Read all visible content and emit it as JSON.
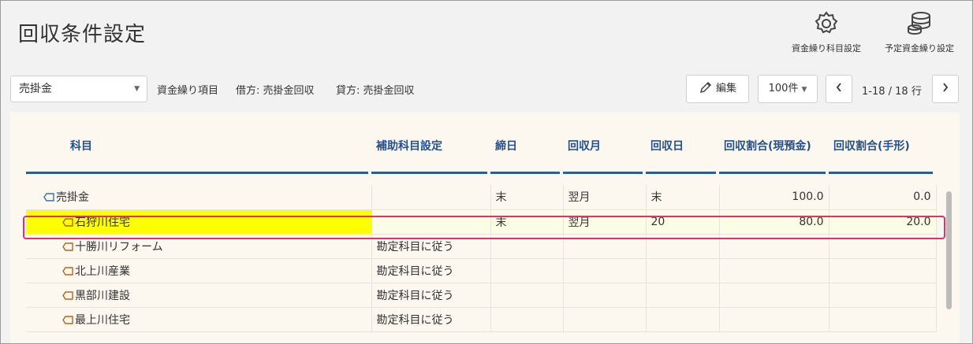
{
  "page": {
    "title": "回収条件設定"
  },
  "header_actions": [
    {
      "label": "資金繰り科目設定",
      "icon": "gear-icon"
    },
    {
      "label": "予定資金繰り設定",
      "icon": "database-icon"
    }
  ],
  "toolbar": {
    "account_select": {
      "value": "売掛金"
    },
    "cashflow_item_label": "資金繰り項目",
    "debit_text": "借方: 売掛金回収",
    "credit_text": "貸方: 売掛金回収",
    "edit_label": "編集",
    "page_size": "100件",
    "paging_text": "1-18 / 18 行"
  },
  "table": {
    "headers": {
      "subject": "科目",
      "sub_setting": "補助科目設定",
      "closing_day": "締日",
      "collection_month": "回収月",
      "collection_day": "回収日",
      "ratio_cash": "回収割合(現預金)",
      "ratio_bill": "回収割合(手形)"
    },
    "rows": [
      {
        "subject": "売掛金",
        "sub_setting": "",
        "closing_day": "末",
        "collection_month": "翌月",
        "collection_day": "末",
        "ratio_cash": "100.0",
        "ratio_bill": "0.0"
      },
      {
        "subject": "石狩川住宅",
        "sub_setting": "",
        "closing_day": "末",
        "collection_month": "翌月",
        "collection_day": "20",
        "ratio_cash": "80.0",
        "ratio_bill": "20.0"
      },
      {
        "subject": "十勝川リフォーム",
        "sub_setting": "勘定科目に従う",
        "closing_day": "",
        "collection_month": "",
        "collection_day": "",
        "ratio_cash": "",
        "ratio_bill": ""
      },
      {
        "subject": "北上川産業",
        "sub_setting": "勘定科目に従う",
        "closing_day": "",
        "collection_month": "",
        "collection_day": "",
        "ratio_cash": "",
        "ratio_bill": ""
      },
      {
        "subject": "黒部川建設",
        "sub_setting": "勘定科目に従う",
        "closing_day": "",
        "collection_month": "",
        "collection_day": "",
        "ratio_cash": "",
        "ratio_bill": ""
      },
      {
        "subject": "最上川住宅",
        "sub_setting": "勘定科目に従う",
        "closing_day": "",
        "collection_month": "",
        "collection_day": "",
        "ratio_cash": "",
        "ratio_bill": ""
      }
    ]
  },
  "colors": {
    "header_text": "#23508c",
    "highlight_yellow": "#ffff00",
    "highlight_border": "#e0306e"
  }
}
